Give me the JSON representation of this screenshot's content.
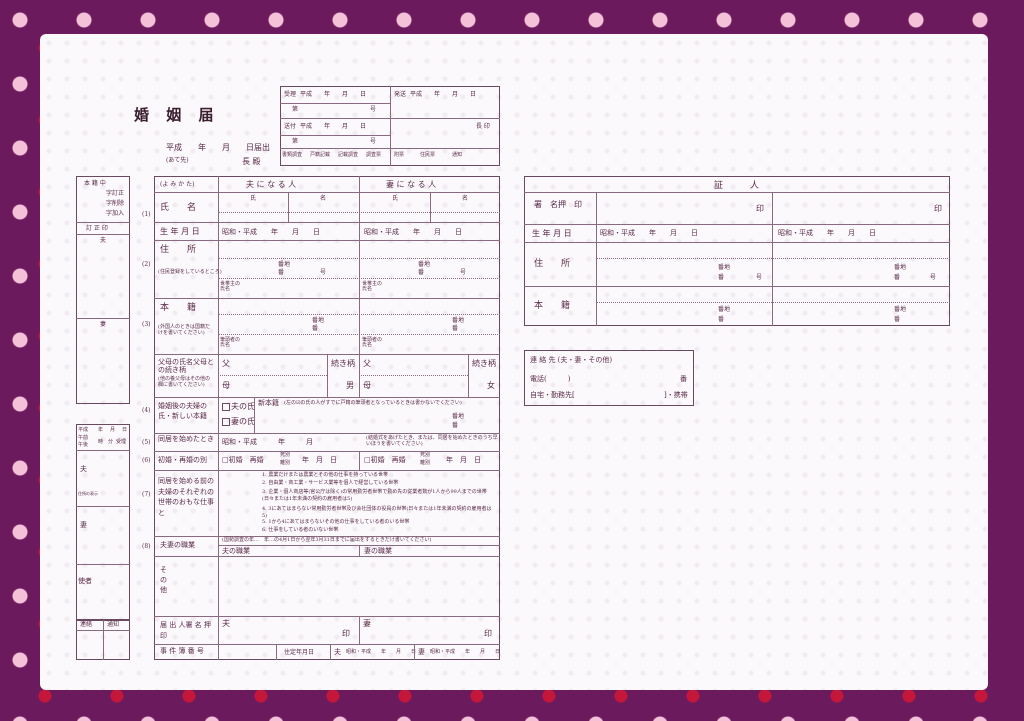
{
  "title": "婚 姻 届",
  "date_line": "平成　　年　　月　　日届出",
  "recipient": "長 殿",
  "recipient_note": "(あて先)",
  "office": {
    "row1": [
      "受理",
      "平成　　年　　月　　日",
      "発送",
      "平成　　年　　月　　日"
    ],
    "row2": [
      "第",
      "号"
    ],
    "row3": [
      "送付",
      "平成　　年　　月　　日",
      "長 印"
    ],
    "row4": [
      "第",
      "号"
    ],
    "row5": [
      "書類調査",
      "戸籍記載",
      "記載調査",
      "調査票",
      "附票",
      "住民票",
      "通知"
    ]
  },
  "left_panel": {
    "head": "本 籍 中",
    "items": [
      "字訂正",
      "字削除",
      "字加入"
    ],
    "seal": "訂 正 印",
    "husband": "夫",
    "wife": "妻"
  },
  "left_panel2": {
    "head": [
      "平成",
      "年",
      "月",
      "日"
    ],
    "rows": [
      "午前",
      "午後",
      "時",
      "分",
      "受理"
    ],
    "husband": "夫",
    "wife": "妻",
    "handler": "使者",
    "note": "住所の表示",
    "foot": [
      "連絡",
      "通知"
    ]
  },
  "main": {
    "kana": "(よ み か た)",
    "col_husband": "夫 に な る 人",
    "col_wife": "妻 に な る 人",
    "name_label": "氏　　名",
    "last": "氏",
    "first": "名",
    "birth_label": "生 年 月 日",
    "birth_value": "昭和・平成　　年　　月　　日",
    "address_label": "住　　所",
    "address_note": "(住民登録をしているところ)",
    "banchi": "番地",
    "ban": "番",
    "go": "号",
    "householder": "世帯主の氏名",
    "honseki_label": "本　　籍",
    "honseki_note": "(外国人のときは国籍だけを書いてください)",
    "hittousha": "筆頭者の氏名",
    "parents_label": "父母の氏名父母との続き柄",
    "parents_note": "(他の養父母はその他の欄に書いてください)",
    "father": "父",
    "mother": "母",
    "relation": "続き柄",
    "son": "男",
    "daughter": "女",
    "new_surname_label": "婚姻後の夫婦の氏・新しい本籍",
    "husband_surname": "夫の氏",
    "wife_surname": "妻の氏",
    "new_honseki": "新本籍",
    "new_honseki_note": "(左の☑の氏の人がすでに戸籍の筆頭者となっているときは書かないでください)",
    "cohab_label": "同居を始めたとき",
    "cohab_value": "昭和・平成　　　年　　　月",
    "cohab_note": "(結婚式をあげたとき、または、同居を始めたときのうち早いほうを書いてください)",
    "first_marriage_label": "初婚・再婚の別",
    "first_marriage": "□初婚　再婚",
    "death": "死別",
    "divorce": "離別",
    "year_month_day": "年　月　日",
    "occupation_label": "同居を始める前の夫婦のそれぞれの世帯のおもな仕事と",
    "occupations": [
      "1. 農業だけまたは農業とその他の仕事を持っている世帯",
      "2. 自由業・商工業・サービス業等を個人で経営している世帯",
      "3. 企業・個人商店等(官公庁は除く)の常用勤労者世帯で勤め先の従業者数が1人から99人までの世帯(日々または1年未満の契約の雇用者は5)",
      "4. 3にあてはまらない常用勤労者世帯及び会社団体の役員の世帯(日々または1年未満の契約の雇用者は5)",
      "5. 1から4にあてはまらないその他の仕事をしている者のいる世帯",
      "6. 仕事をしている者のいない世帯"
    ],
    "job_label": "夫妻の職業",
    "job_note": "(国勢調査の年…　年…の4月1日から翌年3月31日までに届出をするときだけ書いてください)",
    "husband_job": "夫の職業",
    "wife_job": "妻の職業",
    "other_label": "そ の 他",
    "signer_label": "届 出 人署 名 押 印",
    "seal": "印",
    "case_label": "事 件 簿 番 号",
    "residence_date": "住定年月日",
    "residence_value": "昭和・平成　　年　　月　　日"
  },
  "witness": {
    "title": "証　　　人",
    "sign_label": "署　名押　印",
    "seal": "印",
    "birth_label": "生 年 月 日",
    "birth_value": "昭和・平成　　年　　月　　日",
    "address_label": "住　　所",
    "honseki_label": "本　　籍",
    "banchi": "番地",
    "ban": "番",
    "go": "号"
  },
  "contact": {
    "title": "連 絡 先 (夫・妻・その他)",
    "phone": "電話(　　　)",
    "phone_suffix": "番",
    "type": "自宅・勤務先[",
    "type_suffix": "]・携帯"
  },
  "section_numbers": [
    "(1)",
    "(2)",
    "(3)",
    "(4)",
    "(5)",
    "(6)",
    "(7)",
    "(8)"
  ]
}
